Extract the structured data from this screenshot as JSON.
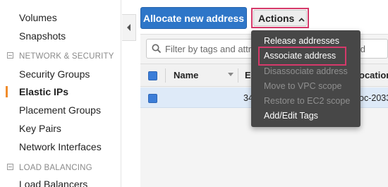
{
  "sidebar": {
    "items_top": [
      {
        "label": "Volumes"
      },
      {
        "label": "Snapshots"
      }
    ],
    "section_network": "NETWORK & SECURITY",
    "network_items": [
      {
        "label": "Security Groups"
      },
      {
        "label": "Elastic IPs",
        "active": true
      },
      {
        "label": "Placement Groups"
      },
      {
        "label": "Key Pairs"
      },
      {
        "label": "Network Interfaces"
      }
    ],
    "section_lb": "LOAD BALANCING",
    "lb_items": [
      {
        "label": "Load Balancers"
      }
    ]
  },
  "toolbar": {
    "allocate_label": "Allocate new address",
    "actions_label": "Actions"
  },
  "search": {
    "placeholder": "Filter by tags and attributes or search by keyword"
  },
  "table": {
    "columns": [
      "Name",
      "E",
      "ocation I"
    ],
    "rows": [
      {
        "name": "",
        "ip_fragment": "34",
        "allocation_fragment": "oc-2033"
      }
    ]
  },
  "actions_menu": {
    "items": [
      {
        "label": "Release addresses",
        "enabled": true
      },
      {
        "label": "Associate address",
        "enabled": true,
        "highlighted": true
      },
      {
        "label": "Disassociate address",
        "enabled": false
      },
      {
        "label": "Move to VPC scope",
        "enabled": false
      },
      {
        "label": "Restore to EC2 scope",
        "enabled": false
      },
      {
        "label": "Add/Edit Tags",
        "enabled": true
      }
    ]
  },
  "colors": {
    "accent_blue": "#2e76c8",
    "highlight_pink": "#d5396a",
    "active_orange": "#f08c2c",
    "menu_bg": "#474747"
  },
  "icons": [
    "collapse-left-icon",
    "search-icon",
    "caret-up-icon",
    "sort-caret-icon",
    "section-collapse-icon"
  ]
}
